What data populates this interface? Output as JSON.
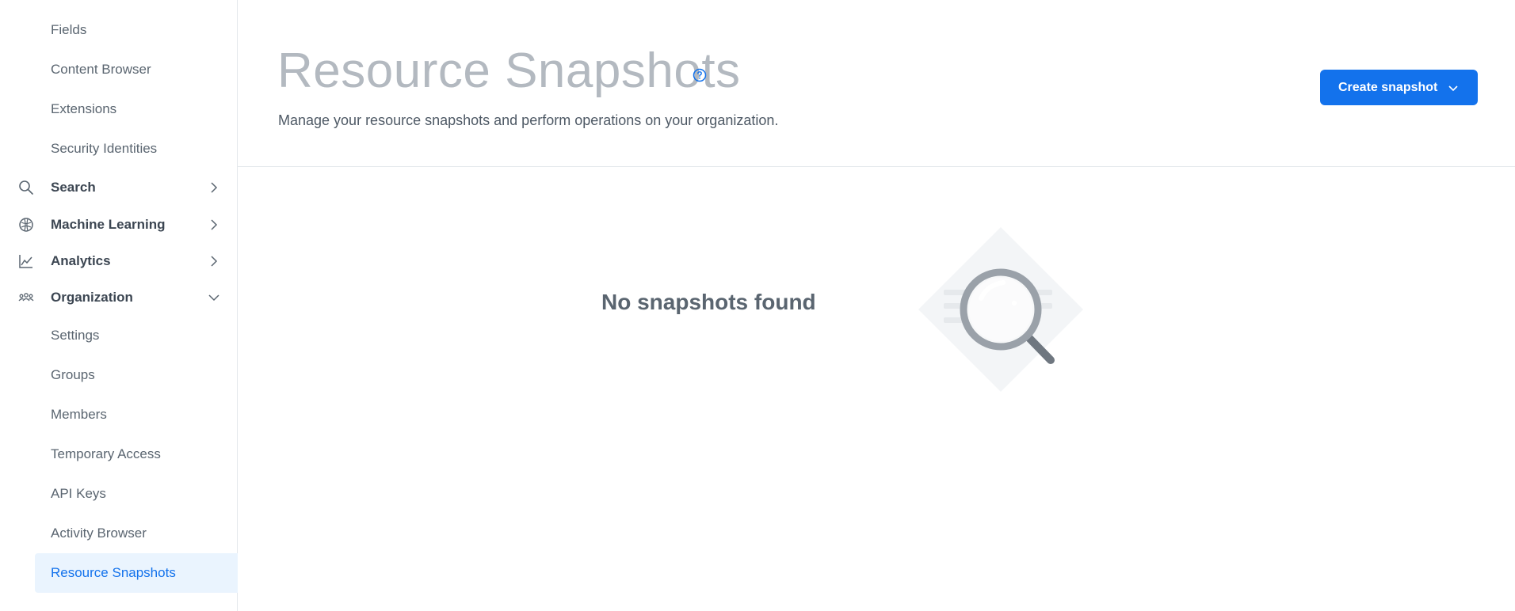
{
  "sidebar": {
    "top_items": [
      {
        "label": "Fields"
      },
      {
        "label": "Content Browser"
      },
      {
        "label": "Extensions"
      },
      {
        "label": "Security Identities"
      }
    ],
    "sections": [
      {
        "label": "Search",
        "icon": "search-icon",
        "expanded": false
      },
      {
        "label": "Machine Learning",
        "icon": "machine-learning-icon",
        "expanded": false
      },
      {
        "label": "Analytics",
        "icon": "analytics-icon",
        "expanded": false
      },
      {
        "label": "Organization",
        "icon": "organization-icon",
        "expanded": true
      }
    ],
    "org_items": [
      {
        "label": "Settings"
      },
      {
        "label": "Groups"
      },
      {
        "label": "Members"
      },
      {
        "label": "Temporary Access"
      },
      {
        "label": "API Keys"
      },
      {
        "label": "Activity Browser"
      },
      {
        "label": "Resource Snapshots",
        "active": true
      }
    ]
  },
  "header": {
    "title": "Resource Snapshots",
    "subtitle": "Manage your resource snapshots and perform operations on your organization.",
    "create_button_label": "Create snapshot"
  },
  "empty_state": {
    "message": "No snapshots found",
    "illustration": "magnifying-glass-icon"
  },
  "colors": {
    "accent": "#1372ec",
    "active_item_bg": "#eaf4fe",
    "title_gray": "#b3b9c0",
    "divider": "#e4e8ec"
  }
}
